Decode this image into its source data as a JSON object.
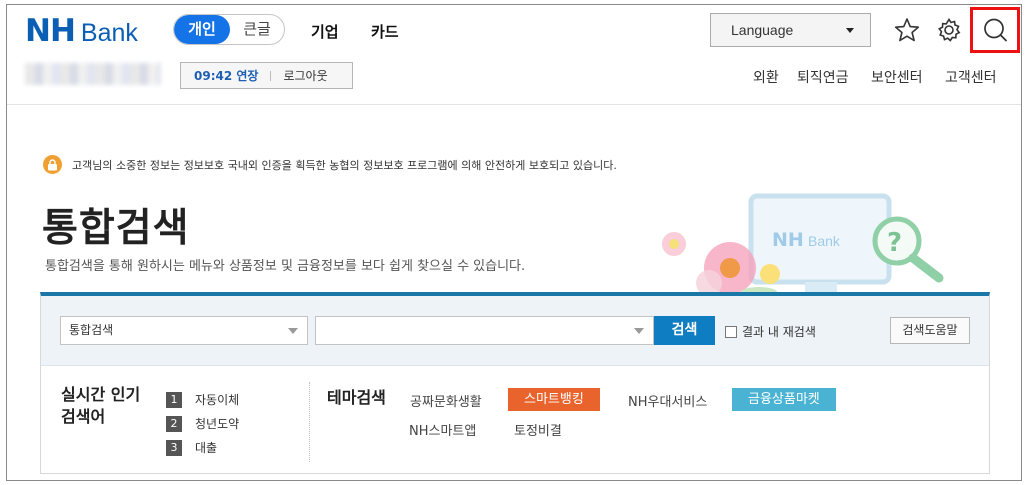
{
  "header": {
    "logo_nh": "NH",
    "logo_bank": "Bank",
    "segment": [
      {
        "label": "개인"
      },
      {
        "label": "큰글"
      }
    ],
    "nav": [
      {
        "label": "기업"
      },
      {
        "label": "카드"
      }
    ],
    "language_label": "Language",
    "icons": [
      "star-icon",
      "gear-icon",
      "search-icon"
    ]
  },
  "session": {
    "time": "09:42 연장",
    "logout": "로그아웃"
  },
  "utility_nav": [
    "외환",
    "퇴직연금",
    "보안센터",
    "고객센터"
  ],
  "notice": "고객님의 소중한 정보는 정보보호 국내외 인증을 획득한 농협의 정보보호 프로그램에 의해 안전하게 보호되고 있습니다.",
  "page_title": "통합검색",
  "page_subtitle": "통합검색을 통해 원하시는 메뉴와 상품정보 및 금융정보를 보다 쉽게 찾으실 수 있습니다.",
  "illustration": {
    "brand_nh": "NH",
    "brand_bank": "Bank",
    "help_glyph": "?"
  },
  "search": {
    "scope_value": "통합검색",
    "query_value": "",
    "button": "검색",
    "within_results": "결과 내 재검색",
    "help": "검색도움말"
  },
  "popular": {
    "title_line1": "실시간 인기",
    "title_line2": "검색어",
    "items": [
      {
        "rank": "1",
        "label": "자동이체"
      },
      {
        "rank": "2",
        "label": "청년도약"
      },
      {
        "rank": "3",
        "label": "대출"
      }
    ]
  },
  "theme": {
    "title": "테마검색",
    "tags": [
      {
        "label": "공짜문화생활",
        "style": "plain"
      },
      {
        "label": "스마트뱅킹",
        "style": "highlight",
        "color": "#e8642c"
      },
      {
        "label": "NH우대서비스",
        "style": "plain"
      },
      {
        "label": "금융상품마켓",
        "style": "highlight",
        "color": "#4ab3d3"
      },
      {
        "label": "NH스마트앱",
        "style": "plain"
      },
      {
        "label": "토정비결",
        "style": "plain"
      }
    ]
  },
  "colors": {
    "brand": "#0a5fb4",
    "accent": "#1473e6",
    "search_button": "#0f7dc1",
    "highlight_box": "#ee1111"
  }
}
